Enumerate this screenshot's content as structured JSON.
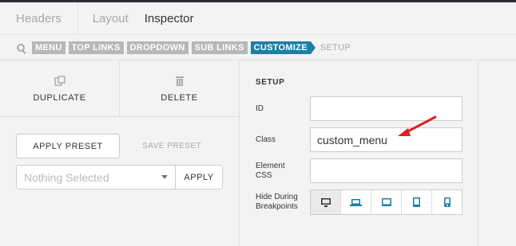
{
  "tabs": [
    {
      "label": "Headers"
    },
    {
      "label": "Layout"
    },
    {
      "label": "Inspector"
    }
  ],
  "breadcrumb": {
    "items": [
      "MENU",
      "TOP LINKS",
      "DROPDOWN",
      "SUB LINKS",
      "CUSTOMIZE"
    ],
    "current": "SETUP"
  },
  "actions": {
    "duplicate": "DUPLICATE",
    "delete": "DELETE"
  },
  "preset": {
    "apply_label": "APPLY PRESET",
    "save_label": "SAVE PRESET",
    "select_placeholder": "Nothing Selected",
    "apply_button": "APPLY"
  },
  "setup": {
    "title": "SETUP",
    "id_label": "ID",
    "id_value": "",
    "class_label": "Class",
    "class_value": "custom_menu",
    "css_label_1": "Element",
    "css_label_2": "CSS",
    "css_value": "",
    "breakpoints_label_1": "Hide During",
    "breakpoints_label_2": "Breakpoints",
    "breakpoint_icons": [
      "desktop-icon",
      "laptop-icon",
      "tablet-landscape-icon",
      "tablet-portrait-icon",
      "phone-icon"
    ]
  },
  "colors": {
    "accent": "#1b7fa6",
    "annotation_arrow": "#e02020"
  }
}
